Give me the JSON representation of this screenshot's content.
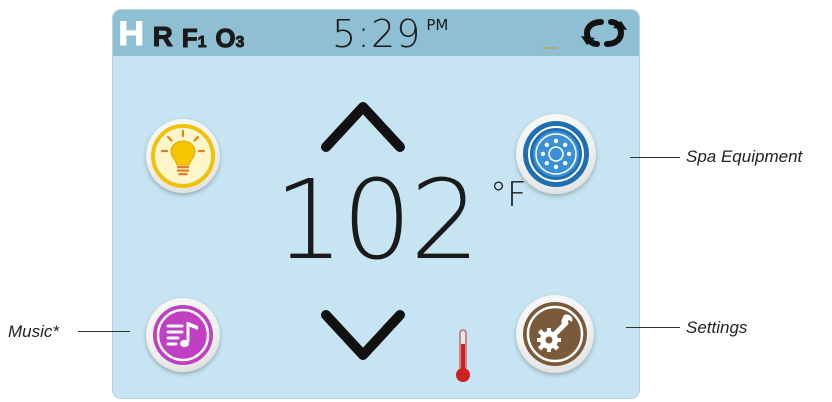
{
  "status_bar": {
    "indicators": {
      "heat": "H",
      "ready": "R",
      "filter_letter": "F",
      "filter_num": "1",
      "ozone_letter": "O",
      "ozone_num": "3"
    },
    "time": "5:29",
    "ampm": "PM",
    "sync_icon": "sync-arrows-icon"
  },
  "main": {
    "temperature": "102",
    "unit": "°F",
    "up_icon": "chevron-up-icon",
    "down_icon": "chevron-down-icon",
    "thermometer_icon": "thermometer-icon"
  },
  "buttons": {
    "light": {
      "icon": "light-bulb-icon",
      "color": "#f2c200"
    },
    "spa_equipment": {
      "icon": "jets-icon",
      "color": "#1f6fb5"
    },
    "music": {
      "icon": "music-note-icon",
      "color": "#c13fc2"
    },
    "settings": {
      "icon": "wrench-gear-icon",
      "color": "#7a5a3a"
    }
  },
  "callouts": {
    "spa_equipment": "Spa Equipment",
    "settings": "Settings",
    "music": "Music*"
  },
  "colors": {
    "screen_bg": "#c6e4f1",
    "status_bar_bg": "#8fbfd3",
    "thermometer": "#cc2222"
  }
}
